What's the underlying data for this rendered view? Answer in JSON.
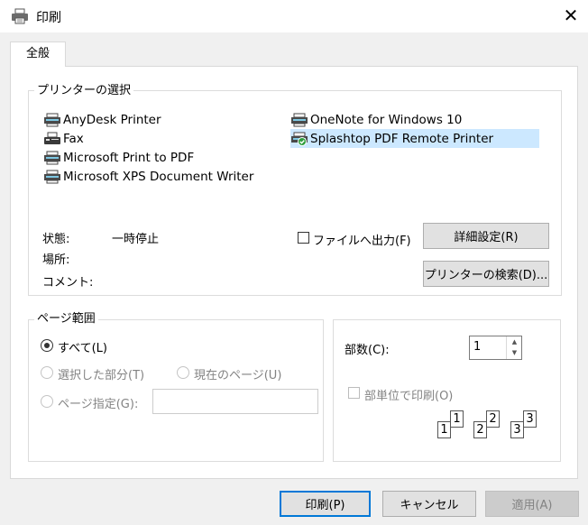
{
  "window": {
    "title": "印刷",
    "icon": "printer-icon",
    "close_icon": "close-icon"
  },
  "tabs": [
    {
      "label": "全般",
      "selected": true
    }
  ],
  "printer_group": {
    "legend": "プリンターの選択",
    "printers_left": [
      {
        "name": "AnyDesk Printer",
        "icon": "network-printer-icon"
      },
      {
        "name": "Fax",
        "icon": "fax-icon"
      },
      {
        "name": "Microsoft Print to PDF",
        "icon": "network-printer-icon"
      },
      {
        "name": "Microsoft XPS Document Writer",
        "icon": "network-printer-icon"
      }
    ],
    "printers_right": [
      {
        "name": "OneNote for Windows 10",
        "icon": "network-printer-icon"
      },
      {
        "name": "Splashtop PDF Remote Printer",
        "icon": "default-printer-icon",
        "selected": true
      }
    ],
    "status_label": "状態:",
    "status_value": "一時停止",
    "location_label": "場所:",
    "location_value": "",
    "comment_label": "コメント:",
    "comment_value": "",
    "print_to_file_label": "ファイルへ出力(F)",
    "print_to_file_checked": false,
    "preferences_button": "詳細設定(R)",
    "find_printer_button": "プリンターの検索(D)..."
  },
  "page_range_group": {
    "legend": "ページ範囲",
    "all_label": "すべて(L)",
    "all_selected": true,
    "selection_label": "選択した部分(T)",
    "current_page_label": "現在のページ(U)",
    "pages_label": "ページ指定(G):",
    "pages_value": ""
  },
  "copies_group": {
    "copies_label": "部数(C):",
    "copies_value": "1",
    "collate_label": "部単位で印刷(O)",
    "collate_checked": false,
    "collate_pages": [
      "1",
      "1",
      "2",
      "2",
      "3",
      "3"
    ]
  },
  "footer": {
    "print_button": "印刷(P)",
    "cancel_button": "キャンセル",
    "apply_button": "適用(A)"
  },
  "colors": {
    "dialog_bg": "#f0f0f0",
    "panel_bg": "#ffffff",
    "selection_bg": "#cce8ff",
    "default_button_border": "#0078d7",
    "disabled_text": "#838383"
  }
}
